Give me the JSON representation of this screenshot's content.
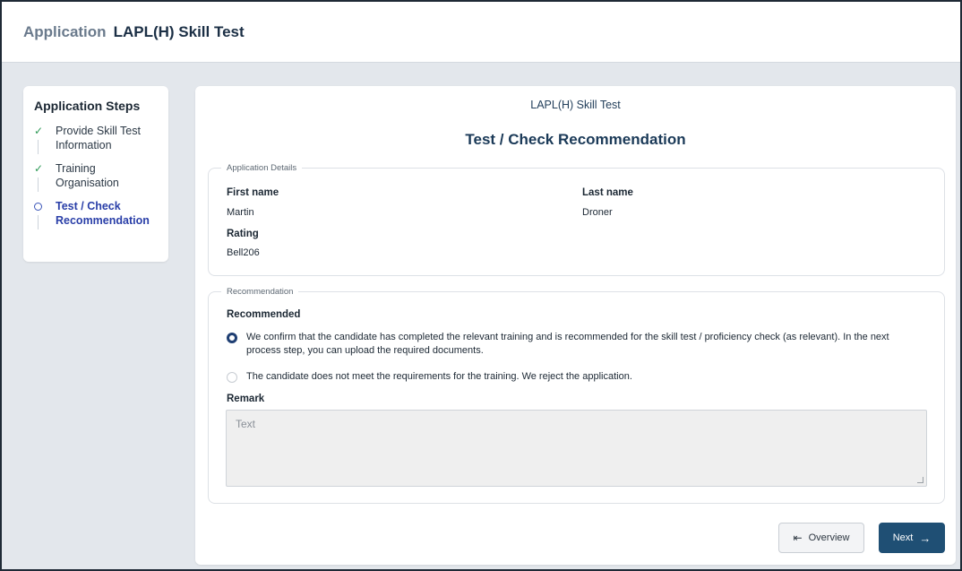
{
  "header": {
    "lead": "Application",
    "title": "LAPL(H) Skill Test"
  },
  "steps": {
    "title": "Application Steps",
    "items": [
      {
        "label": "Provide Skill Test Information",
        "status": "completed",
        "icon": "check-icon"
      },
      {
        "label": "Training Organisation",
        "status": "completed",
        "icon": "check-icon"
      },
      {
        "label": "Test / Check Recommendation",
        "status": "current",
        "icon": "circle-icon"
      }
    ]
  },
  "main": {
    "subtitle": "LAPL(H) Skill Test",
    "heading": "Test / Check Recommendation",
    "application_details": {
      "legend": "Application Details",
      "first_name_label": "First name",
      "first_name": "Martin",
      "last_name_label": "Last name",
      "last_name": "Droner",
      "rating_label": "Rating",
      "rating": "Bell206"
    },
    "recommendation": {
      "legend": "Recommendation",
      "question": "Recommended",
      "options": [
        {
          "text": "We confirm that the candidate has completed the relevant training and is recommended for the skill test / proficiency check (as relevant). In the next process step, you can upload the required documents.",
          "selected": true
        },
        {
          "text": "The candidate does not meet the requirements for the training. We reject the application.",
          "selected": false
        }
      ],
      "remark_label": "Remark",
      "remark_placeholder": "Text"
    },
    "buttons": {
      "overview": "Overview",
      "overview_icon": "exit-icon",
      "next": "Next",
      "next_icon": "arrow-right-icon"
    }
  },
  "colors": {
    "primary": "#1f4f74",
    "completed": "#2f9a57",
    "active_step": "#2a3fa8",
    "background": "#e3e7ec"
  }
}
